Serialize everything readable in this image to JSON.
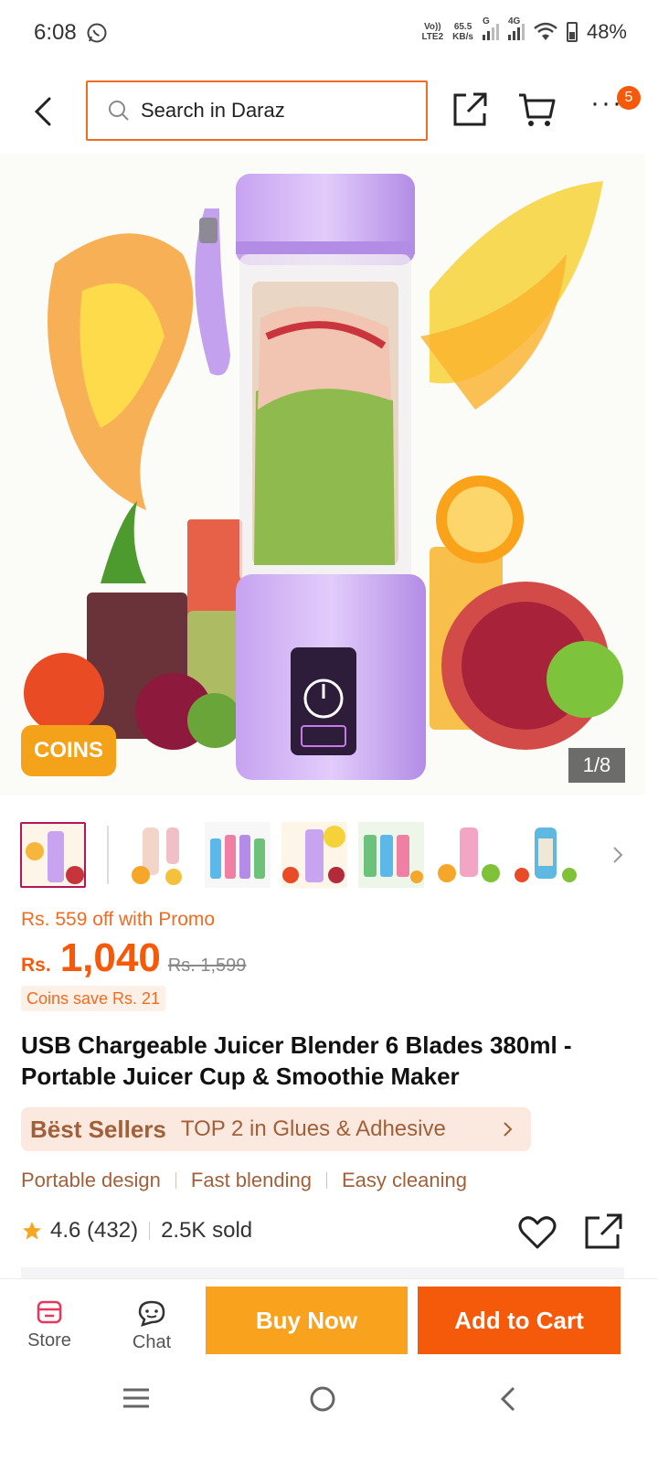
{
  "status_bar": {
    "time": "6:08",
    "network_label_top": "Vo))",
    "network_label_bottom": "LTE2",
    "speed_value": "65.5",
    "speed_unit": "KB/s",
    "signal1_label": "G",
    "signal2_label": "4G",
    "battery": "48%"
  },
  "header": {
    "search_placeholder": "Search in Daraz",
    "cart_badge": "5"
  },
  "gallery": {
    "coins_badge": "COINS",
    "counter": "1/8",
    "thumbnail_count": 7
  },
  "product": {
    "promo": "Rs. 559 off with Promo",
    "currency": "Rs.",
    "price": "1,040",
    "old_price": "Rs. 1,599",
    "coins_save": "Coins save Rs. 21",
    "title": "USB Chargeable Juicer Blender 6 Blades 380ml - Portable Juicer Cup & Smoothie Maker",
    "best_sellers_label": "Bëst Sellers",
    "rank_text": "TOP 2 in Glues & Adhesive",
    "features": [
      "Portable design",
      "Fast blending",
      "Easy cleaning"
    ],
    "rating": "4.6 (432)",
    "sold": "2.5K sold"
  },
  "bottom_bar": {
    "store_label": "Store",
    "chat_label": "Chat",
    "buy_now": "Buy Now",
    "add_to_cart": "Add to Cart"
  },
  "colors": {
    "accent_orange": "#f55a0a",
    "buy_now_yellow": "#f8a21d",
    "bestseller_brown": "#a1603a",
    "coins_yellow": "#f3a21a"
  }
}
